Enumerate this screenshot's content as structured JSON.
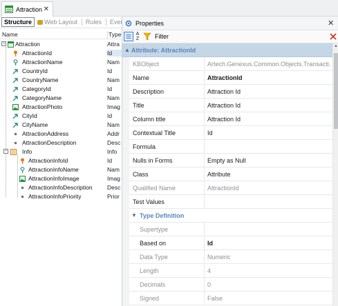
{
  "tab": {
    "label": "Attraction"
  },
  "subtabs": [
    {
      "label": "Structure"
    },
    {
      "label": "Web Layout"
    },
    {
      "label": "Rules"
    },
    {
      "label": "Event"
    }
  ],
  "tree_header": {
    "name": "Name",
    "type": "Type"
  },
  "tree": [
    {
      "name": "Attraction",
      "type": "Attra"
    },
    {
      "name": "AttractionId",
      "type": "Id"
    },
    {
      "name": "AttractionName",
      "type": "Nam"
    },
    {
      "name": "CountryId",
      "type": "Id"
    },
    {
      "name": "CountryName",
      "type": "Nam"
    },
    {
      "name": "CategoryId",
      "type": "Id"
    },
    {
      "name": "CategoryName",
      "type": "Nam"
    },
    {
      "name": "AttractionPhoto",
      "type": "Imag"
    },
    {
      "name": "CityId",
      "type": "Id"
    },
    {
      "name": "CityName",
      "type": "Nam"
    },
    {
      "name": "AttractionAddress",
      "type": "Addr"
    },
    {
      "name": "AttractionDescription",
      "type": "Desc"
    },
    {
      "name": "Info",
      "type": "Info"
    },
    {
      "name": "AttractionInfoId",
      "type": "Id"
    },
    {
      "name": "AttractionInfoName",
      "type": "Nam"
    },
    {
      "name": "AttractionInfoImage",
      "type": "Imag"
    },
    {
      "name": "AttractionInfoDescription",
      "type": "Desc"
    },
    {
      "name": "AttractionInfoPriority",
      "type": "Prior"
    }
  ],
  "properties": {
    "title": "Properties",
    "filter_label": "Filter",
    "category": "Attribute: AttractionId",
    "rows": [
      {
        "key": "KBObject",
        "value": "Artech.Genexus.Common.Objects.Transacti..."
      },
      {
        "key": "Name",
        "value": "AttractionId"
      },
      {
        "key": "Description",
        "value": "Attraction Id"
      },
      {
        "key": "Title",
        "value": "Attraction Id"
      },
      {
        "key": "Column title",
        "value": "Attraction Id"
      },
      {
        "key": "Contextual Title",
        "value": "Id"
      },
      {
        "key": "Formula",
        "value": ""
      },
      {
        "key": "Nulls in Forms",
        "value": "Empty as Null"
      },
      {
        "key": "Class",
        "value": "Attribute"
      },
      {
        "key": "Qualified Name",
        "value": "AttractionId"
      },
      {
        "key": "Test Values",
        "value": ""
      }
    ],
    "type_definition": {
      "label": "Type Definition",
      "rows": [
        {
          "key": "Supertype",
          "value": ""
        },
        {
          "key": "Based on",
          "value": "Id"
        },
        {
          "key": "Data Type",
          "value": "Numeric"
        },
        {
          "key": "Length",
          "value": "4"
        },
        {
          "key": "Decimals",
          "value": "0"
        },
        {
          "key": "Signed",
          "value": "False"
        }
      ]
    }
  },
  "icons": {
    "tab": "transaction-icon",
    "root": "transaction-icon",
    "key": "key-icon",
    "attribute": "attribute-icon",
    "foreign_key": "foreign-key-arrow-icon",
    "image": "image-icon",
    "level": "level-icon",
    "description": "dot-icon"
  }
}
